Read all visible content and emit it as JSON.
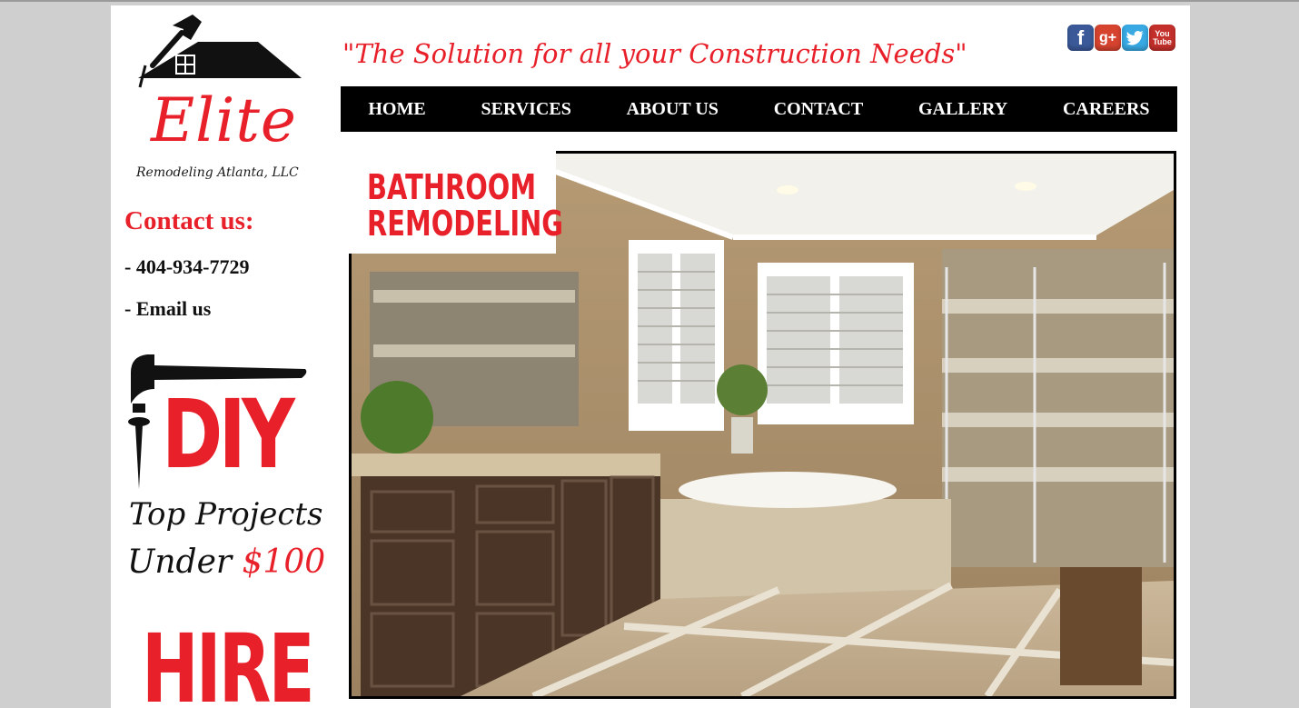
{
  "brand": {
    "name": "Elite",
    "subtitle": "Remodeling Atlanta, LLC"
  },
  "tagline": "\"The Solution for all your Construction Needs\"",
  "social": {
    "facebook": "f",
    "google_plus": "g+",
    "twitter": "t",
    "youtube_top": "You",
    "youtube_bottom": "Tube"
  },
  "nav": {
    "items": [
      "HOME",
      "SERVICES",
      "ABOUT US",
      "CONTACT",
      "GALLERY",
      "CAREERS"
    ]
  },
  "sidebar": {
    "contact_title": "Contact us:",
    "phone": "- 404-934-7729",
    "email": "- Email us",
    "diy": {
      "word": "DIY",
      "line1": "Top Projects",
      "line2_prefix": "Under ",
      "line2_price": "$100"
    },
    "hire_word": "HIRE"
  },
  "hero": {
    "label_line1": "BATHROOM",
    "label_line2": "REMODELING"
  },
  "colors": {
    "accent": "#e8202a",
    "nav_background": "#000000",
    "page_background": "#ffffff",
    "outer_background": "#cfcfcf"
  }
}
